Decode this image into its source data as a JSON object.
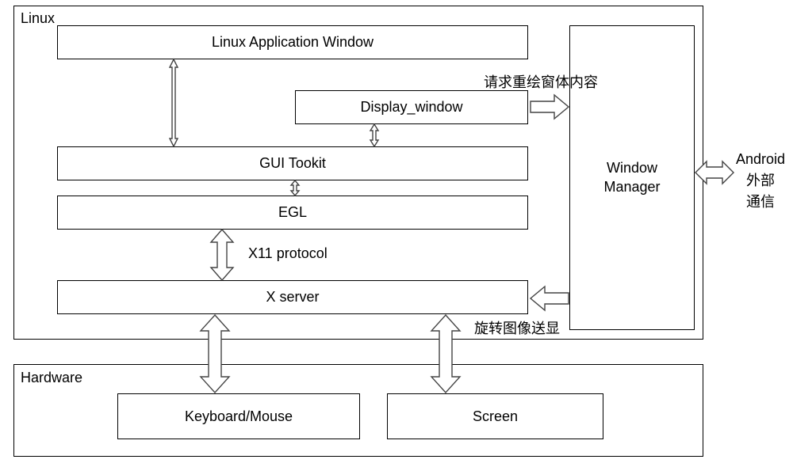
{
  "groups": {
    "linux": "Linux",
    "hardware": "Hardware"
  },
  "boxes": {
    "app_window": "Linux Application Window",
    "display_window": "Display_window",
    "gui_toolkit": "GUI Tookit",
    "egl": "EGL",
    "xserver": "X server",
    "window_manager": "Window\nManager",
    "keyboard_mouse": "Keyboard/Mouse",
    "screen": "Screen"
  },
  "labels": {
    "x11_protocol": "X11 protocol",
    "request_redraw": "请求重绘窗体内容",
    "rotate_image": "旋转图像送显",
    "android_comm": "Android\n外部\n通信"
  }
}
